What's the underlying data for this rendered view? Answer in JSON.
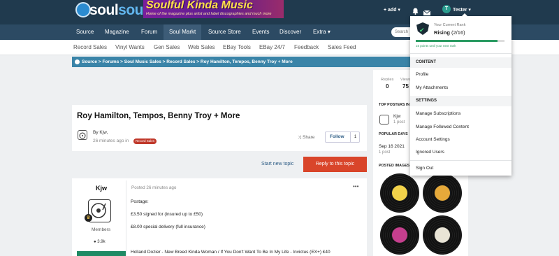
{
  "header": {
    "logo": {
      "prefix": "soul",
      "suffix": "source"
    },
    "banner": {
      "title": "Soulful Kinda Music",
      "subtitle": "Home of the magazine plus artist and label discographies and much more"
    },
    "add_label": "+ add ▾",
    "user_name": "Tester ▾",
    "user_initial": "T"
  },
  "nav": {
    "items": [
      "Source",
      "Magazine",
      "Forum",
      "Soul Markt",
      "Source Store",
      "Events",
      "Discover",
      "Extra ▾"
    ],
    "active": "Soul Markt",
    "search_placeholder": "Search"
  },
  "subnav": {
    "items": [
      "Record Sales",
      "Vinyl Wants",
      "Gen Sales",
      "Web Sales",
      "EBay Tools",
      "EBay 24/7",
      "Feedback",
      "Sales Feed"
    ]
  },
  "breadcrumb": [
    "Source",
    "Forums",
    "Soul Music Sales",
    "Record Sales",
    "Roy Hamilton, Tempos, Benny Troy + More"
  ],
  "topic": {
    "title": "Roy Hamilton, Tempos, Benny Troy + More",
    "by_label": "By Kjw,",
    "time_label": "26 minutes ago in",
    "badge": "Record Sales",
    "share_label": "Share",
    "follow_label": "Follow",
    "follow_count": "1"
  },
  "actions": {
    "start_topic": "Start new topic",
    "reply": "Reply to this topic"
  },
  "post": {
    "author": "Kjw",
    "role": "Members",
    "reputation": "3.9k",
    "posted": "Posted 26 minutes ago",
    "lines": [
      "Postage:",
      "£3.50 signed for (insured up to £50)",
      "£8.00 special delivery (full insurance)",
      "Holland Dozier - New Breed Kinda Woman / If You Don't Want To Be In My Life - Invictus (EX+) £40"
    ]
  },
  "sidebar": {
    "stats": [
      {
        "label": "Replies",
        "value": "0"
      },
      {
        "label": "Views",
        "value": "75"
      }
    ],
    "top_posters_heading": "TOP POSTERS IN THIS TOPIC",
    "top_poster": {
      "name": "Kjw",
      "count": "1 post"
    },
    "popular_days_heading": "POPULAR DAYS",
    "popular_day": {
      "date": "Sep 16 2021",
      "count": "1 post"
    },
    "posted_images_heading": "POSTED IMAGES"
  },
  "user_menu": {
    "rank_caption": "Your Current Rank",
    "rank_name": "Rising",
    "rank_progress": "(2/16)",
    "rank_fraction": 0.92,
    "rank_note": "15 points until your next rank",
    "content_heading": "CONTENT",
    "content_items": [
      "Profile",
      "My Attachments"
    ],
    "settings_heading": "SETTINGS",
    "settings_items": [
      "Manage Subscriptions",
      "Manage Followed Content",
      "Account Settings",
      "Ignored Users"
    ],
    "sign_out": "Sign Out"
  },
  "colors": {
    "header": "#203a4e",
    "nav": "#2c4a63",
    "breadcrumb": "#3a84a8",
    "reply": "#d9452a",
    "badge": "#c0392b",
    "progress": "#2a9b62"
  }
}
